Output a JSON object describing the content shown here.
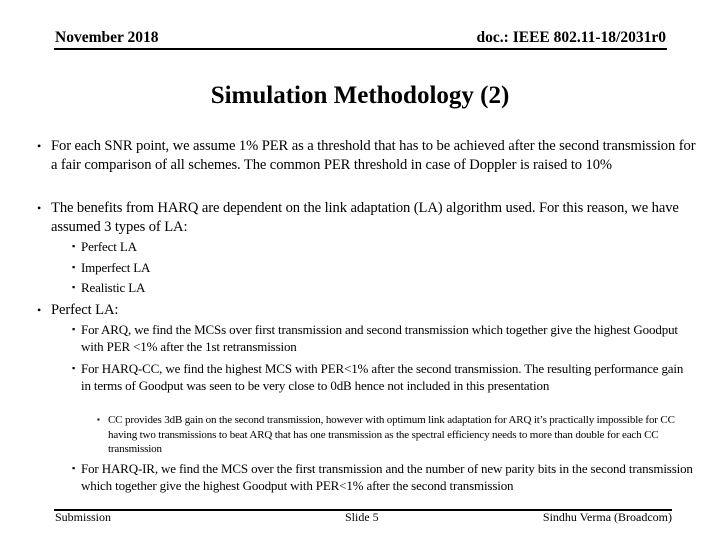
{
  "header": {
    "date": "November 2018",
    "doc_id": "doc.: IEEE 802.11-18/2031r0"
  },
  "title": "Simulation Methodology (2)",
  "bullets": [
    {
      "text": "For each SNR point, we assume 1% PER as a threshold that has to be achieved after the second transmission for a fair comparison of all schemes. The common PER threshold in case of Doppler is raised to 10%"
    },
    {
      "text": "The benefits from HARQ are dependent on the link adaptation (LA) algorithm used. For this reason, we have assumed 3 types of LA:",
      "sub": [
        {
          "text": "Perfect LA"
        },
        {
          "text": "Imperfect LA"
        },
        {
          "text": "Realistic LA"
        }
      ]
    },
    {
      "text": "Perfect LA:",
      "sub": [
        {
          "text": "For ARQ, we find the MCSs over first transmission and second transmission which together give the highest Goodput with PER <1% after the 1st retransmission"
        },
        {
          "text": "For HARQ-CC, we find the highest MCS with PER<1% after the second transmission. The resulting performance gain in terms of Goodput was seen to be very close to 0dB hence not included in this presentation",
          "sub": [
            {
              "text": "CC provides 3dB gain on the second transmission, however with optimum link adaptation for ARQ it’s practically impossible for CC having two transmissions to beat ARQ that has one transmission as the spectral efficiency needs to more than double for each CC transmission"
            }
          ]
        },
        {
          "text": "For HARQ-IR, we find the MCS over the first transmission and the number of new parity bits in the second transmission which together give the highest Goodput with PER<1% after the second transmission"
        }
      ]
    }
  ],
  "bullet_glyphs": {
    "level1": "•",
    "level2": "▪",
    "level3": "▪"
  },
  "footer": {
    "left": "Submission",
    "center": "Slide 5",
    "right": "Sindhu Verma (Broadcom)"
  }
}
